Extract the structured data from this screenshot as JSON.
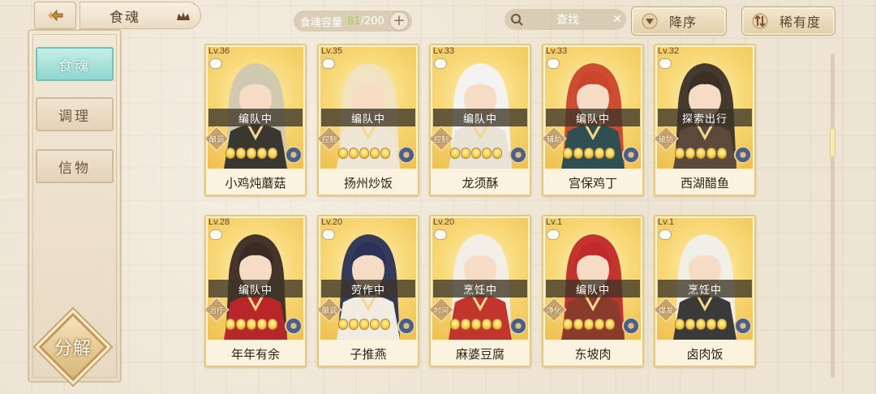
{
  "topbar": {
    "tab_title": "食魂",
    "capacity_label": "食魂容量",
    "capacity_current": "81",
    "capacity_max": "/200",
    "plus": "+",
    "search_text": "查找",
    "search_clear": "✕",
    "sort_label": "降序",
    "rarity_label": "稀有度"
  },
  "side": {
    "tabs": [
      {
        "label": "食魂",
        "active": true
      },
      {
        "label": "调理",
        "active": false
      },
      {
        "label": "信物",
        "active": false
      }
    ],
    "decompose_label": "分解"
  },
  "colors": {
    "accent_teal": "#8fd6ce",
    "card_gold": "#efbf4e",
    "status_green": "#a6d05a"
  },
  "cards": [
    {
      "level": "Lv.36",
      "status": "编队中",
      "role": "酿调",
      "name": "小鸡炖蘑菇",
      "stars": 5,
      "hair": "#cfc8b0",
      "outfit": "#3a3630"
    },
    {
      "level": "Lv.35",
      "status": "编队中",
      "role": "控制",
      "name": "扬州炒饭",
      "stars": 5,
      "hair": "#f1e3c3",
      "outfit": "#efe6d6"
    },
    {
      "level": "Lv.33",
      "status": "编队中",
      "role": "控制",
      "name": "龙须酥",
      "stars": 5,
      "hair": "#f3f3f3",
      "outfit": "#e9e2d6"
    },
    {
      "level": "Lv.33",
      "status": "编队中",
      "role": "辅助",
      "name": "宫保鸡丁",
      "stars": 5,
      "hair": "#c9452c",
      "outfit": "#2f4f52"
    },
    {
      "level": "Lv.32",
      "status": "探索出行",
      "role": "破防",
      "name": "西湖醋鱼",
      "stars": 5,
      "hair": "#3b3028",
      "outfit": "#5b4a3b"
    },
    {
      "level": "Lv.28",
      "status": "编队中",
      "role": "治疗",
      "name": "年年有余",
      "stars": 5,
      "hair": "#3a2a24",
      "outfit": "#b8262a"
    },
    {
      "level": "Lv.20",
      "status": "劳作中",
      "role": "酿调",
      "name": "子推燕",
      "stars": 5,
      "hair": "#2b3158",
      "outfit": "#f0ece2"
    },
    {
      "level": "Lv.20",
      "status": "烹饪中",
      "role": "时间",
      "name": "麻婆豆腐",
      "stars": 5,
      "hair": "#f2efe8",
      "outfit": "#c2352c"
    },
    {
      "level": "Lv.1",
      "status": "编队中",
      "role": "净化",
      "name": "东坡肉",
      "stars": 5,
      "hair": "#c02a2a",
      "outfit": "#8a3b2c"
    },
    {
      "level": "Lv.1",
      "status": "烹饪中",
      "role": "爆发",
      "name": "卤肉饭",
      "stars": 5,
      "hair": "#f1efe9",
      "outfit": "#3a3a3a"
    }
  ]
}
